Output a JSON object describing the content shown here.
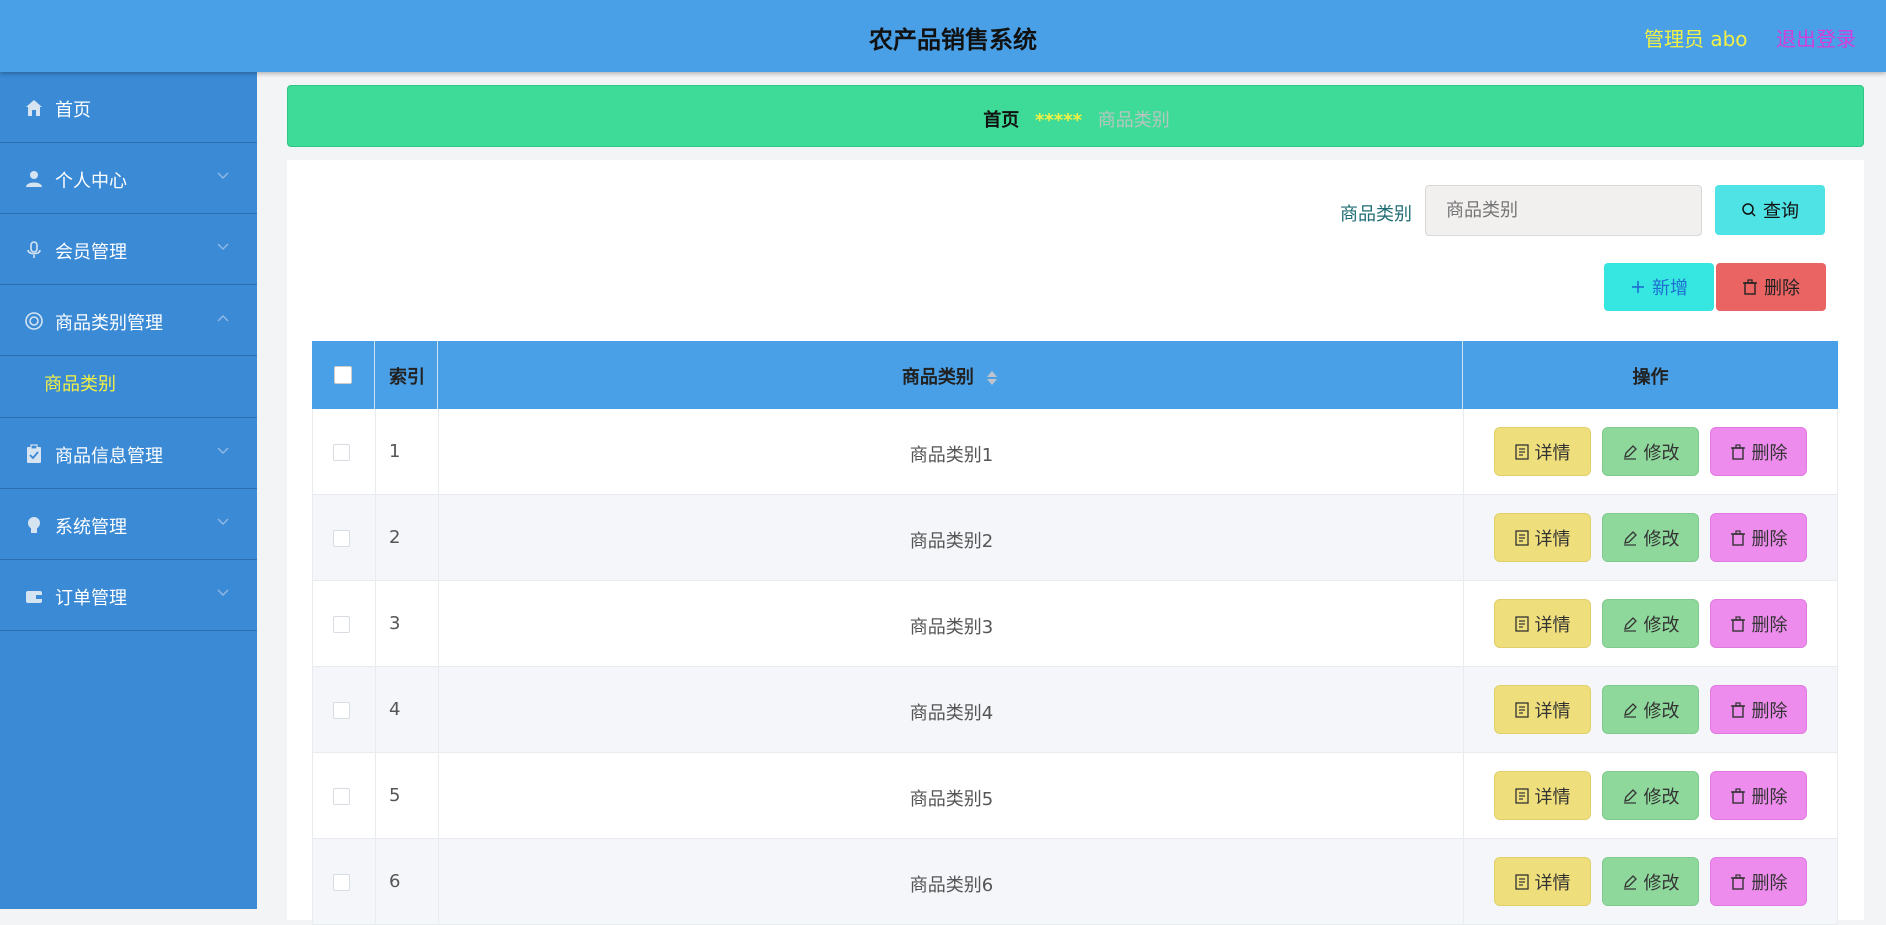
{
  "header": {
    "title": "农产品销售系统",
    "admin_label": "管理员 abo",
    "logout_label": "退出登录"
  },
  "sidebar": {
    "items": [
      {
        "label": "首页",
        "icon": "home-icon",
        "has_arrow": false
      },
      {
        "label": "个人中心",
        "icon": "user-icon",
        "has_arrow": true,
        "arrow": "down"
      },
      {
        "label": "会员管理",
        "icon": "microphone-icon",
        "has_arrow": true,
        "arrow": "down"
      },
      {
        "label": "商品类别管理",
        "icon": "lifebuoy-icon",
        "has_arrow": true,
        "arrow": "up"
      },
      {
        "label": "商品信息管理",
        "icon": "clipboard-icon",
        "has_arrow": true,
        "arrow": "down"
      },
      {
        "label": "系统管理",
        "icon": "bulb-icon",
        "has_arrow": true,
        "arrow": "down"
      },
      {
        "label": "订单管理",
        "icon": "wallet-icon",
        "has_arrow": true,
        "arrow": "down"
      }
    ],
    "submenu_active": "商品类别"
  },
  "breadcrumb": {
    "home": "首页",
    "separator": "*****",
    "current": "商品类别"
  },
  "search": {
    "label": "商品类别",
    "placeholder": "商品类别",
    "button_label": "查询"
  },
  "toolbar": {
    "add_label": "新增",
    "delete_label": "删除"
  },
  "table": {
    "columns": {
      "index": "索引",
      "category": "商品类别",
      "actions": "操作"
    },
    "rows": [
      {
        "index": "1",
        "category": "商品类别1"
      },
      {
        "index": "2",
        "category": "商品类别2"
      },
      {
        "index": "3",
        "category": "商品类别3"
      },
      {
        "index": "4",
        "category": "商品类别4"
      },
      {
        "index": "5",
        "category": "商品类别5"
      },
      {
        "index": "6",
        "category": "商品类别6"
      }
    ],
    "row_actions": {
      "detail": "详情",
      "edit": "修改",
      "delete": "删除"
    }
  },
  "colors": {
    "header_bg": "#4aa0e6",
    "sidebar_bg": "#3a8ad6",
    "breadcrumb_bg": "#3ddb97",
    "accent_yellow": "#f3f045",
    "logout_color": "#d43cdd",
    "detail_btn": "#efdf7c",
    "edit_btn": "#8fd89c",
    "delete_btn": "#ee8cee"
  }
}
